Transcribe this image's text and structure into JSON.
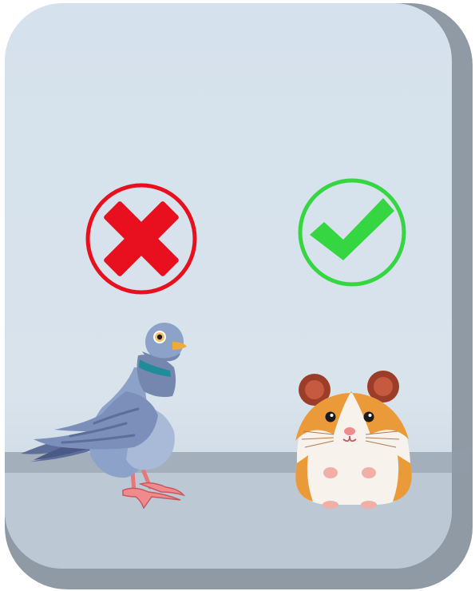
{
  "scene": {
    "wrong_choice": {
      "icon": "cross-icon",
      "animal": "pigeon",
      "color": "#e8101e"
    },
    "right_choice": {
      "icon": "checkmark-icon",
      "animal": "hamster",
      "color": "#35d641"
    }
  },
  "colors": {
    "wall": "#d5e1ec",
    "wall_band": "#a3afbb",
    "floor": "#bcc9d5",
    "card_shadow": "#8f9aa5"
  }
}
